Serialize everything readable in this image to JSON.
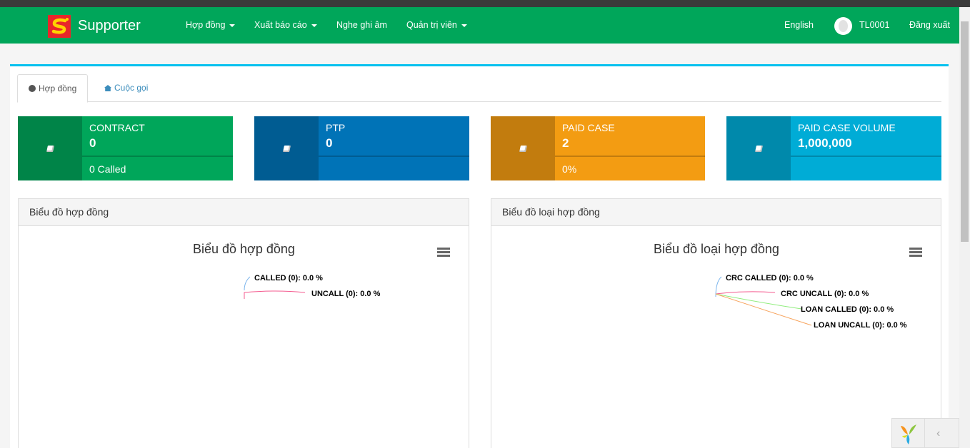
{
  "header": {
    "brand": "Supporter",
    "nav": [
      "Hợp đồng",
      "Xuất báo cáo",
      "Nghe ghi âm",
      "Quản trị viên"
    ],
    "language": "English",
    "username": "TL0001",
    "logout": "Đăng xuất",
    "bar_color": "#00a65a"
  },
  "tabs": [
    {
      "label": "Hợp đồng",
      "icon": "info-circle-icon"
    },
    {
      "label": "Cuộc gọi",
      "icon": "home-icon"
    }
  ],
  "info_boxes": [
    {
      "label": "CONTRACT",
      "value": "0",
      "desc": "0 Called",
      "color": "#00a65a",
      "icon": "book-icon"
    },
    {
      "label": "PTP",
      "value": "0",
      "desc": "",
      "color": "#0073b7",
      "icon": "book-icon"
    },
    {
      "label": "PAID CASE",
      "value": "2",
      "desc": "0%",
      "color": "#f39c12",
      "icon": "book-icon"
    },
    {
      "label": "PAID CASE VOLUME",
      "value": "1,000,000",
      "desc": "",
      "color": "#00acd6",
      "icon": "book-icon"
    }
  ],
  "panels": [
    {
      "header": "Biểu đồ hợp đồng",
      "chart_title": "Biểu đồ hợp đồng"
    },
    {
      "header": "Biểu đồ loại hợp đồng",
      "chart_title": "Biểu đồ loại hợp đồng"
    }
  ],
  "chart_data": [
    {
      "type": "pie",
      "title": "Biểu đồ hợp đồng",
      "labels": [
        "CALLED",
        "UNCALL"
      ],
      "values": [
        0,
        0
      ],
      "data_labels": [
        "CALLED (0): 0.0 %",
        "UNCALL (0): 0.0 %"
      ],
      "colors": [
        "#7cb5ec",
        "#f45b5b"
      ]
    },
    {
      "type": "pie",
      "title": "Biểu đồ loại hợp đồng",
      "labels": [
        "CRC CALLED",
        "CRC UNCALL",
        "LOAN CALLED",
        "LOAN UNCALL"
      ],
      "values": [
        0,
        0,
        0,
        0
      ],
      "data_labels": [
        "CRC CALLED (0): 0.0 %",
        "CRC UNCALL (0): 0.0 %",
        "LOAN CALLED (0): 0.0 %",
        "LOAN UNCALL (0): 0.0 %"
      ],
      "colors": [
        "#7cb5ec",
        "#f45b8f",
        "#90ed7d",
        "#f7a35c"
      ]
    }
  ]
}
